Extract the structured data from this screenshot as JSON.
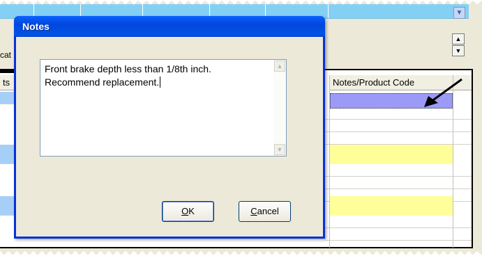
{
  "background": {
    "left_labels": [
      "cat",
      "ts"
    ],
    "grid": {
      "header": "Notes/Product Code",
      "highlight_color": "#9b9bf7",
      "row_colors": [
        "#ffffff",
        "#ffff99"
      ]
    },
    "colors": {
      "strip": "#84d0f4",
      "blue_cell": "#a6cff8"
    }
  },
  "dialog": {
    "title": "Notes",
    "text_line1": "Front brake depth less than 1/8th inch.",
    "text_line2": "Recommend replacement.",
    "ok_label": "OK",
    "ok_mnemonic": "O",
    "ok_rest": "K",
    "cancel_label": "Cancel",
    "cancel_mnemonic": "C",
    "cancel_rest": "ancel"
  },
  "icons": {
    "dropdown": "chevron-down-icon",
    "spin_up": "arrow-up-icon",
    "spin_down": "arrow-down-icon",
    "pointer": "pointer-arrow-icon"
  }
}
